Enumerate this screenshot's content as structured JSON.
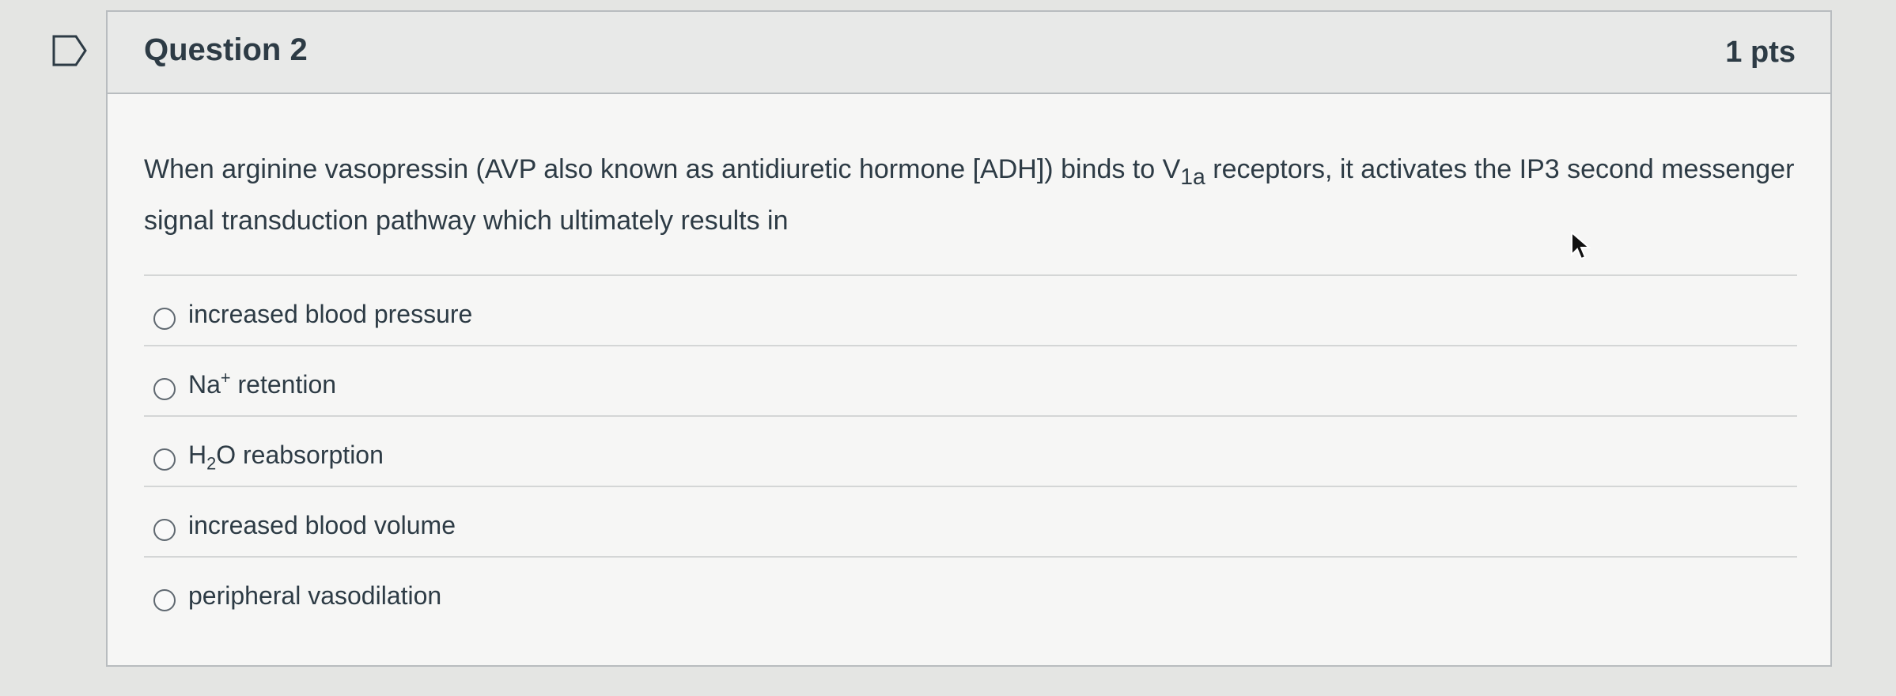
{
  "question": {
    "title": "Question 2",
    "points": "1 pts",
    "text_before": "When arginine vasopressin (AVP also known as antidiuretic hormone [ADH]) binds to V",
    "text_sub": "1a",
    "text_after": " receptors, it activates the IP3 second messenger signal transduction pathway which ultimately results in"
  },
  "answers": [
    {
      "prefix": "increased blood pressure",
      "sup": "",
      "sub": "",
      "suffix": ""
    },
    {
      "prefix": "Na",
      "sup": "+",
      "sub": "",
      "suffix": " retention"
    },
    {
      "prefix": "H",
      "sup": "",
      "sub": "2",
      "suffix": "O reabsorption"
    },
    {
      "prefix": "increased blood volume",
      "sup": "",
      "sub": "",
      "suffix": ""
    },
    {
      "prefix": "peripheral vasodilation",
      "sup": "",
      "sub": "",
      "suffix": ""
    }
  ],
  "icons": {
    "flag": "flag-outline-icon",
    "cursor": "mouse-pointer-icon"
  },
  "colors": {
    "text": "#2d3b45",
    "header_bg": "#e8e9e8",
    "border": "#b8bcbf"
  }
}
